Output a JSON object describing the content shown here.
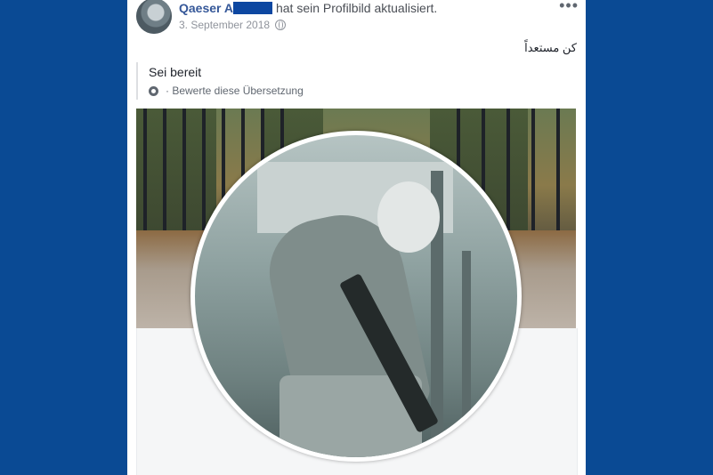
{
  "post": {
    "author": "Qaeser A",
    "action": "hat sein Profilbild aktualisiert.",
    "date": "3. September 2018",
    "menu_icon": "more-horizontal-icon",
    "privacy_icon": "globe-icon",
    "text_original": "كن مستعداً",
    "translation": "Sei bereit",
    "rate_translation": "· Bewerte diese Übersetzung",
    "rate_icon": "gear-icon"
  },
  "colors": {
    "background": "#0a4a94",
    "author_link": "#365899",
    "redaction": "#0d47a1"
  }
}
